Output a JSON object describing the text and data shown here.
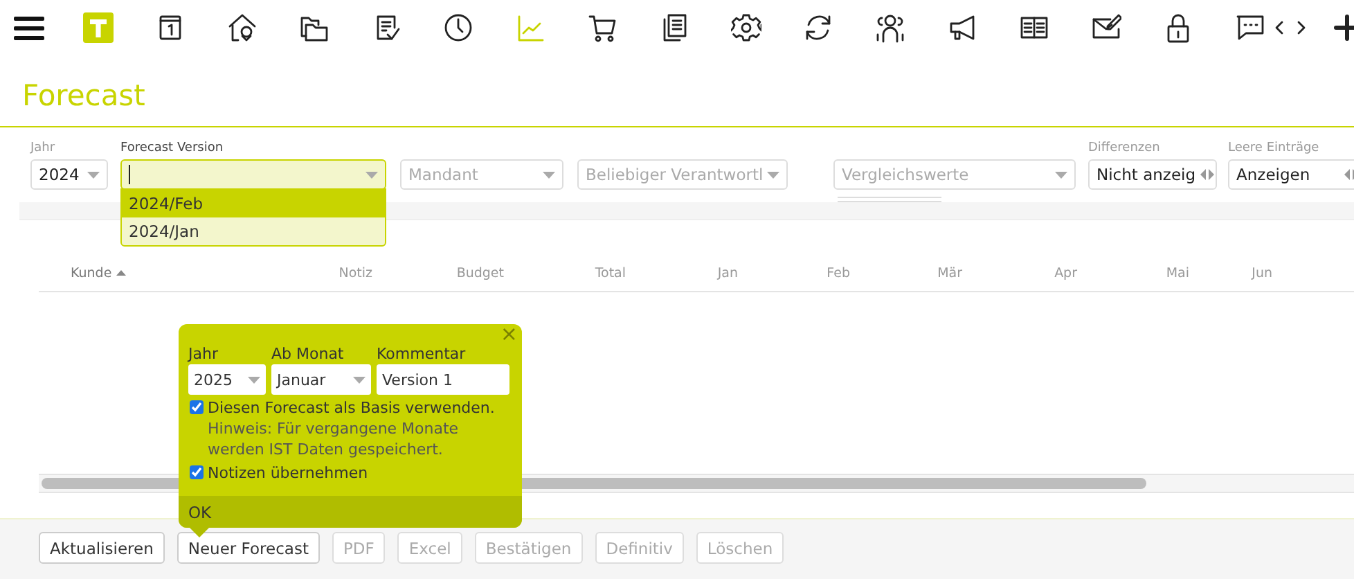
{
  "toolbar": [
    {
      "kind": "menu",
      "selected": false
    },
    {
      "kind": "logo",
      "selected": false
    },
    {
      "kind": "calendar",
      "selected": false
    },
    {
      "kind": "house",
      "selected": false
    },
    {
      "kind": "folders",
      "selected": false
    },
    {
      "kind": "checklist",
      "selected": false
    },
    {
      "kind": "clock",
      "selected": false
    },
    {
      "kind": "chart",
      "selected": true
    },
    {
      "kind": "cart",
      "selected": false
    },
    {
      "kind": "documents",
      "selected": false
    },
    {
      "kind": "gear",
      "selected": false
    },
    {
      "kind": "refresh",
      "selected": false
    },
    {
      "kind": "people",
      "selected": false
    },
    {
      "kind": "megaphone",
      "selected": false
    },
    {
      "kind": "book",
      "selected": false
    },
    {
      "kind": "mail",
      "selected": false
    },
    {
      "kind": "lock",
      "selected": false
    },
    {
      "kind": "chat",
      "selected": false
    },
    {
      "kind": "prev",
      "selected": false
    },
    {
      "kind": "next",
      "selected": false
    },
    {
      "kind": "plus",
      "selected": false
    }
  ],
  "title": "Forecast",
  "filters": [
    {
      "label": "Jahr",
      "value": "2024",
      "kind": "select",
      "focused": false
    },
    {
      "label": "Forecast Version",
      "kind": "select",
      "focused": true
    },
    {
      "placeholder": "Mandant",
      "kind": "select",
      "focused": false
    },
    {
      "placeholder": "Beliebiger Verantwortl",
      "kind": "select",
      "focused": false
    },
    {
      "placeholder": "Vergleichswerte",
      "kind": "select",
      "focused": false
    },
    {
      "label": "Differenzen",
      "value": "Nicht anzeig",
      "kind": "spinner",
      "focused": false
    },
    {
      "label": "Leere Einträge",
      "value": "Anzeigen",
      "kind": "spinner",
      "focused": false
    }
  ],
  "version_dropdown": [
    {
      "label": "2024/Feb",
      "selected": true
    },
    {
      "label": "2024/Jan",
      "selected": false
    }
  ],
  "table": {
    "columns": [
      {
        "label": "Kunde",
        "sorted": true
      },
      {
        "label": "Notiz",
        "sorted": false
      },
      {
        "label": "Budget",
        "sorted": false
      },
      {
        "label": "Total",
        "sorted": false
      },
      {
        "label": "Jan",
        "sorted": false
      },
      {
        "label": "Feb",
        "sorted": false
      },
      {
        "label": "Mär",
        "sorted": false
      },
      {
        "label": "Apr",
        "sorted": false
      },
      {
        "label": "Mai",
        "sorted": false
      },
      {
        "label": "Jun",
        "sorted": false
      }
    ]
  },
  "popup": {
    "fields": [
      {
        "label": "Jahr",
        "value": "2025",
        "kind": "select"
      },
      {
        "label": "Ab Monat",
        "value": "Januar",
        "kind": "select"
      },
      {
        "label": "Kommentar",
        "value": "Version 1",
        "kind": "text"
      }
    ],
    "options": [
      {
        "label": "Diesen Forecast als Basis verwenden.",
        "note": "Hinweis: Für vergangene Monate werden IST Daten gespeichert.",
        "checked": true
      },
      {
        "label": "Notizen übernehmen",
        "checked": true
      }
    ],
    "close": "×",
    "ok": "OK"
  },
  "buttons": [
    {
      "label": "Aktualisieren",
      "disabled": false
    },
    {
      "label": "Neuer Forecast",
      "disabled": false
    },
    {
      "label": "PDF",
      "disabled": true
    },
    {
      "label": "Excel",
      "disabled": true
    },
    {
      "label": "Bestätigen",
      "disabled": true
    },
    {
      "label": "Definitiv",
      "disabled": true
    },
    {
      "label": "Löschen",
      "disabled": true
    }
  ]
}
